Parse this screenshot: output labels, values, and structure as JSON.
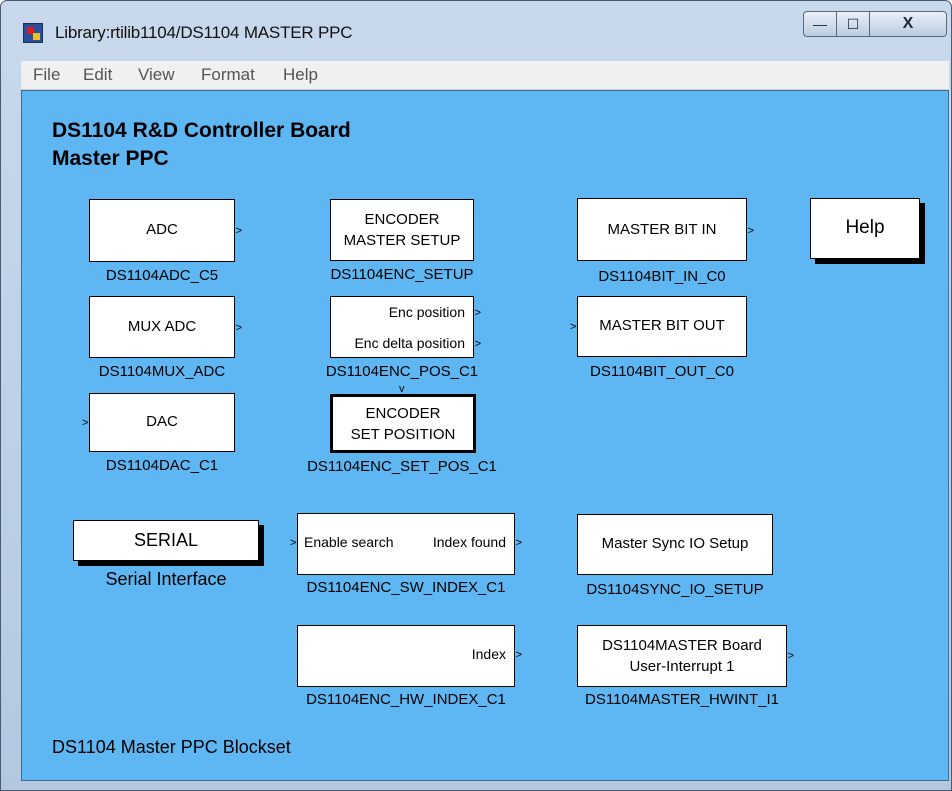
{
  "window": {
    "title": "Library:rtilib1104/DS1104 MASTER PPC",
    "controls": {
      "minimize": "—",
      "maximize": "☐",
      "close": "X"
    }
  },
  "menu": [
    "File",
    "Edit",
    "View",
    "Format",
    "Help"
  ],
  "heading": {
    "line1": "DS1104 R&D Controller Board",
    "line2": "Master PPC"
  },
  "blocks": {
    "adc": {
      "text": "ADC",
      "label": "DS1104ADC_C5"
    },
    "mux_adc": {
      "text": "MUX ADC",
      "label": "DS1104MUX_ADC"
    },
    "dac": {
      "text": "DAC",
      "label": "DS1104DAC_C1"
    },
    "enc_setup": {
      "line1": "ENCODER",
      "line2": "MASTER SETUP",
      "label": "DS1104ENC_SETUP"
    },
    "enc_pos": {
      "port1": "Enc position",
      "port2": "Enc delta position",
      "label": "DS1104ENC_POS_C1"
    },
    "enc_set_pos": {
      "line1": "ENCODER",
      "line2": "SET POSITION",
      "label": "DS1104ENC_SET_POS_C1"
    },
    "bit_in": {
      "text": "MASTER BIT IN",
      "label": "DS1104BIT_IN_C0"
    },
    "bit_out": {
      "text": "MASTER BIT OUT",
      "label": "DS1104BIT_OUT_C0"
    },
    "help": {
      "text": "Help"
    },
    "serial": {
      "text": "SERIAL",
      "label": "Serial Interface"
    },
    "sw_index": {
      "port_in": "Enable search",
      "port_out": "Index found",
      "label": "DS1104ENC_SW_INDEX_C1"
    },
    "sync_io": {
      "text": "Master Sync IO Setup",
      "label": "DS1104SYNC_IO_SETUP"
    },
    "hw_index": {
      "port_out": "Index",
      "label": "DS1104ENC_HW_INDEX_C1"
    },
    "hwint": {
      "line1": "DS1104MASTER Board",
      "line2": "User-Interrupt 1",
      "label": "DS1104MASTER_HWINT_I1"
    }
  },
  "footer": "DS1104 Master PPC Blockset"
}
